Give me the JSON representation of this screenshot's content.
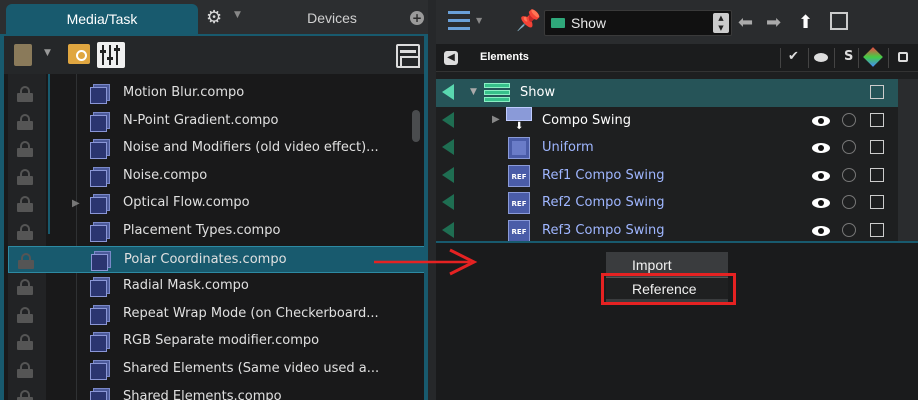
{
  "left_panel": {
    "tabs": {
      "media_task": "Media/Task",
      "devices": "Devices",
      "gear_icon": "gear-icon",
      "add_icon": "plus-icon"
    },
    "toolbar": {
      "book_icon": "book-icon",
      "folder_icon": "folder-search-icon",
      "sliders_icon": "sliders-icon",
      "layout_icon": "layout-icon"
    },
    "items": [
      {
        "label": "Motion Blur.compo",
        "expandable": false,
        "selected": false
      },
      {
        "label": "N-Point Gradient.compo",
        "expandable": false,
        "selected": false
      },
      {
        "label": "Noise and Modifiers (old video effect)...",
        "expandable": false,
        "selected": false
      },
      {
        "label": "Noise.compo",
        "expandable": false,
        "selected": false
      },
      {
        "label": "Optical Flow.compo",
        "expandable": true,
        "selected": false
      },
      {
        "label": "Placement Types.compo",
        "expandable": false,
        "selected": false
      },
      {
        "label": "Polar Coordinates.compo",
        "expandable": false,
        "selected": true
      },
      {
        "label": "Radial Mask.compo",
        "expandable": false,
        "selected": false
      },
      {
        "label": "Repeat Wrap Mode (on Checkerboard...",
        "expandable": false,
        "selected": false
      },
      {
        "label": "RGB Separate modifier.compo",
        "expandable": false,
        "selected": false
      },
      {
        "label": "Shared Elements (Same video used a...",
        "expandable": false,
        "selected": false
      },
      {
        "label": "Shared Elements.compo",
        "expandable": false,
        "selected": false
      }
    ]
  },
  "right_panel": {
    "toolbar": {
      "selected_show": "Show",
      "list_icon": "list-view-icon",
      "pin_icon": "pin-icon",
      "back_icon": "arrow-left-icon",
      "forward_icon": "arrow-right-icon",
      "up_icon": "arrow-up-icon",
      "edit_icon": "edit-icon"
    },
    "header": {
      "title": "Elements",
      "col_check": "✔",
      "col_solo": "S"
    },
    "elements": [
      {
        "label": "Show",
        "kind": "show",
        "is_ref": false
      },
      {
        "label": "Compo Swing",
        "kind": "swing",
        "is_ref": false
      },
      {
        "label": "Uniform",
        "kind": "uniform",
        "is_ref": true
      },
      {
        "label": "Ref1 Compo Swing",
        "kind": "ref",
        "is_ref": true
      },
      {
        "label": "Ref2 Compo Swing",
        "kind": "ref",
        "is_ref": true
      },
      {
        "label": "Ref3 Compo Swing",
        "kind": "ref",
        "is_ref": true
      }
    ],
    "ref_badge": "REF"
  },
  "context_menu": {
    "items": [
      "Import",
      "Reference"
    ],
    "highlighted": "Reference"
  },
  "colors": {
    "accent_teal": "#185a6e",
    "annotation_red": "#e52222",
    "ref_label": "#9fb6ff"
  }
}
